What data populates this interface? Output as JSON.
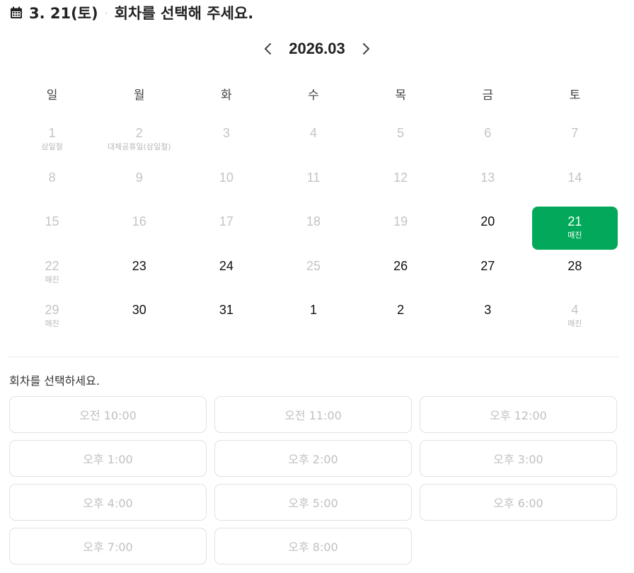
{
  "header": {
    "selected_date": "3. 21(토)",
    "separator": "·",
    "prompt": "회차를 선택해 주세요."
  },
  "month_nav": {
    "label": "2026.03"
  },
  "weekdays": [
    "일",
    "월",
    "화",
    "수",
    "목",
    "금",
    "토"
  ],
  "calendar": {
    "days": [
      {
        "num": "1",
        "sub": "삼일절",
        "state": "disabled"
      },
      {
        "num": "2",
        "sub": "대체공휴일(삼일절)",
        "state": "disabled"
      },
      {
        "num": "3",
        "sub": "",
        "state": "disabled"
      },
      {
        "num": "4",
        "sub": "",
        "state": "disabled"
      },
      {
        "num": "5",
        "sub": "",
        "state": "disabled"
      },
      {
        "num": "6",
        "sub": "",
        "state": "disabled"
      },
      {
        "num": "7",
        "sub": "",
        "state": "disabled"
      },
      {
        "num": "8",
        "sub": "",
        "state": "disabled"
      },
      {
        "num": "9",
        "sub": "",
        "state": "disabled"
      },
      {
        "num": "10",
        "sub": "",
        "state": "disabled"
      },
      {
        "num": "11",
        "sub": "",
        "state": "disabled"
      },
      {
        "num": "12",
        "sub": "",
        "state": "disabled"
      },
      {
        "num": "13",
        "sub": "",
        "state": "disabled"
      },
      {
        "num": "14",
        "sub": "",
        "state": "disabled"
      },
      {
        "num": "15",
        "sub": "",
        "state": "disabled"
      },
      {
        "num": "16",
        "sub": "",
        "state": "disabled"
      },
      {
        "num": "17",
        "sub": "",
        "state": "disabled"
      },
      {
        "num": "18",
        "sub": "",
        "state": "disabled"
      },
      {
        "num": "19",
        "sub": "",
        "state": "disabled"
      },
      {
        "num": "20",
        "sub": "",
        "state": "available"
      },
      {
        "num": "21",
        "sub": "매진",
        "state": "selected"
      },
      {
        "num": "22",
        "sub": "매진",
        "state": "disabled"
      },
      {
        "num": "23",
        "sub": "",
        "state": "available"
      },
      {
        "num": "24",
        "sub": "",
        "state": "available"
      },
      {
        "num": "25",
        "sub": "",
        "state": "disabled"
      },
      {
        "num": "26",
        "sub": "",
        "state": "available"
      },
      {
        "num": "27",
        "sub": "",
        "state": "available"
      },
      {
        "num": "28",
        "sub": "",
        "state": "available"
      },
      {
        "num": "29",
        "sub": "매진",
        "state": "disabled"
      },
      {
        "num": "30",
        "sub": "",
        "state": "available"
      },
      {
        "num": "31",
        "sub": "",
        "state": "available"
      },
      {
        "num": "1",
        "sub": "",
        "state": "available"
      },
      {
        "num": "2",
        "sub": "",
        "state": "available"
      },
      {
        "num": "3",
        "sub": "",
        "state": "available"
      },
      {
        "num": "4",
        "sub": "매진",
        "state": "disabled"
      }
    ]
  },
  "slots": {
    "label": "회차를 선택하세요.",
    "items": [
      "오전 10:00",
      "오전 11:00",
      "오후 12:00",
      "오후 1:00",
      "오후 2:00",
      "오후 3:00",
      "오후 4:00",
      "오후 5:00",
      "오후 6:00",
      "오후 7:00",
      "오후 8:00"
    ]
  },
  "colors": {
    "selected": "#03a95a",
    "disabled_text": "#c4c4c4",
    "text": "#222222"
  },
  "icons": {
    "header": "calendar-icon",
    "prev": "chevron-left-icon",
    "next": "chevron-right-icon"
  }
}
